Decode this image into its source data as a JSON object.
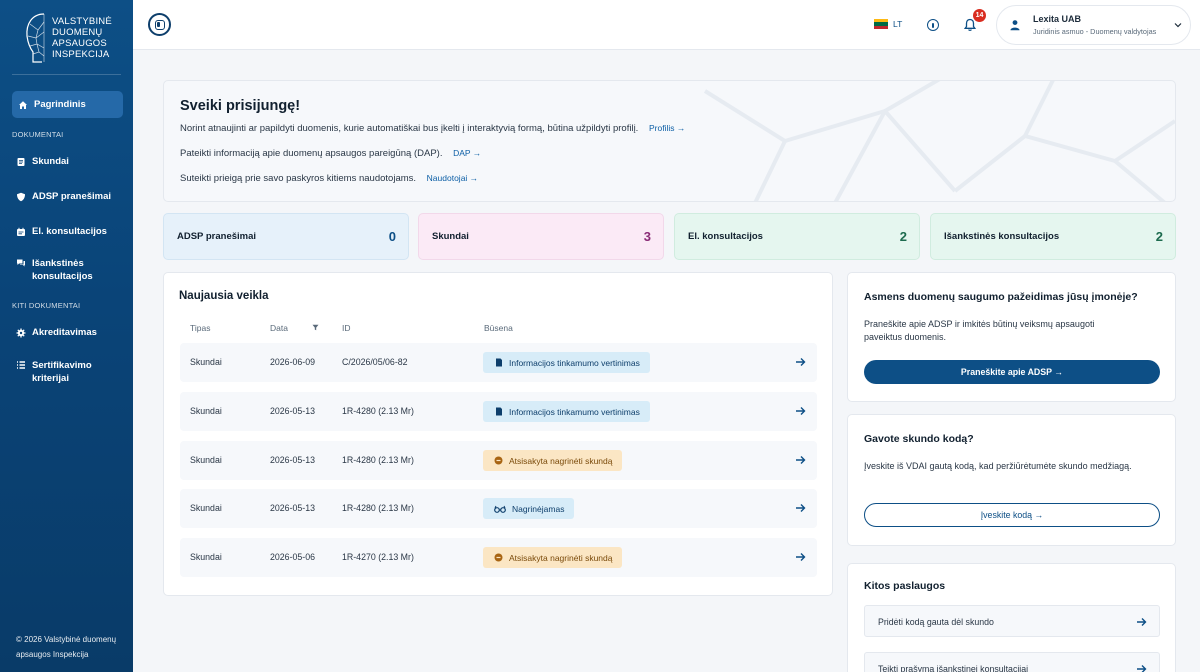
{
  "sidebar": {
    "logo_lines": [
      "Valstybinė",
      "duomenų",
      "apsaugos",
      "inspekcija"
    ],
    "home": "Pagrindinis",
    "group_documents": "Dokumentai",
    "items_documents": [
      "Skundai",
      "ADSP pranešimai",
      "El. konsultacijos",
      "Išankstinės konsultacijos"
    ],
    "group_other": "Kiti dokumentai",
    "items_other": [
      "Akreditavimas",
      "Sertifikavimo kriterijai"
    ],
    "footer_line1": "© 2026 Valstybinė duomenų",
    "footer_line2": "apsaugos Inspekcija"
  },
  "topbar": {
    "language": "LT",
    "notifications_count": "14",
    "user_name": "Lexita UAB",
    "user_role": "Juridinis asmuo - Duomenų valdytojas"
  },
  "welcome": {
    "title": "Sveiki prisijungę!",
    "line1": "Norint atnaujinti ar papildyti duomenis, kurie automatiškai bus įkelti į interaktyvią formą, būtina užpildyti profilį.",
    "link1": "Profilis →",
    "line2": "Pateikti informaciją apie duomenų apsaugos pareigūną (DAP).",
    "link2": "DAP →",
    "line3": "Suteikti prieigą prie savo paskyros kitiems naudotojams.",
    "link3": "Naudotojai →"
  },
  "stats": [
    {
      "label": "ADSP pranešimai",
      "value": "0"
    },
    {
      "label": "Skundai",
      "value": "3"
    },
    {
      "label": "El. konsultacijos",
      "value": "2"
    },
    {
      "label": "Išankstinės konsultacijos",
      "value": "2"
    }
  ],
  "activity": {
    "title": "Naujausia veikla",
    "headers": {
      "type": "Tipas",
      "date": "Data",
      "id": "ID",
      "status": "Būsena"
    },
    "rows": [
      {
        "type": "Skundai",
        "date": "2026-06-09",
        "id": "C/2026/05/06-82",
        "status": "Informacijos tinkamumo vertinimas"
      },
      {
        "type": "Skundai",
        "date": "2026-05-13",
        "id": "1R-4280 (2.13 Mr)",
        "status": "Informacijos tinkamumo vertinimas"
      },
      {
        "type": "Skundai",
        "date": "2026-05-13",
        "id": "1R-4280 (2.13 Mr)",
        "status": "Atsisakyta nagrinėti skundą"
      },
      {
        "type": "Skundai",
        "date": "2026-05-13",
        "id": "1R-4280 (2.13 Mr)",
        "status": "Nagrinėjamas"
      },
      {
        "type": "Skundai",
        "date": "2026-05-06",
        "id": "1R-4270 (2.13 Mr)",
        "status": "Atsisakyta nagrinėti skundą"
      }
    ]
  },
  "breach_card": {
    "title": "Asmens duomenų saugumo pažeidimas jūsų įmonėje?",
    "text": "Praneškite apie ADSP ir imkitės būtinų veiksmų apsaugoti paveiktus duomenis.",
    "button": "Praneškite apie ADSP →"
  },
  "code_card": {
    "title": "Gavote skundo kodą?",
    "text": "Įveskite iš VDAI gautą kodą, kad peržiūrėtumėte skundo medžiagą.",
    "button": "Įveskite kodą →"
  },
  "services_card": {
    "title": "Kitos paslaugos",
    "items": [
      "Pridėti kodą gauta dėl skundo",
      "Teikti prašymą išankstinei konsultacijai"
    ]
  },
  "colors": {
    "sidebar": "#0a4478",
    "primary": "#0d4f86",
    "stat_blue": "#e6f1fa",
    "stat_pink": "#fbeaf6",
    "stat_green": "#e5f6ef",
    "status_blue": "#d7ecf8",
    "status_orange": "#fbe6c4"
  }
}
